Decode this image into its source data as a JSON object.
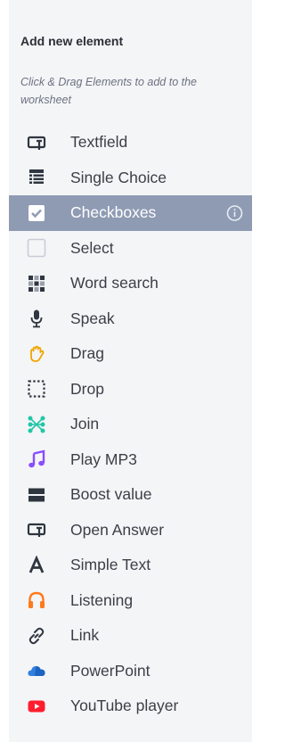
{
  "panel": {
    "title": "Add new element",
    "hint": "Click & Drag Elements to add to the worksheet"
  },
  "elements": [
    {
      "label": "Textfield",
      "icon": "textfield-icon"
    },
    {
      "label": "Single Choice",
      "icon": "single-choice-icon"
    },
    {
      "label": "Checkboxes",
      "icon": "checkbox-icon",
      "selected": true
    },
    {
      "label": "Select",
      "icon": "select-icon"
    },
    {
      "label": "Word search",
      "icon": "word-search-icon"
    },
    {
      "label": "Speak",
      "icon": "microphone-icon"
    },
    {
      "label": "Drag",
      "icon": "hand-icon"
    },
    {
      "label": "Drop",
      "icon": "dotted-box-icon"
    },
    {
      "label": "Join",
      "icon": "join-icon"
    },
    {
      "label": "Play MP3",
      "icon": "music-note-icon"
    },
    {
      "label": "Boost value",
      "icon": "boost-value-icon"
    },
    {
      "label": "Open Answer",
      "icon": "open-answer-icon"
    },
    {
      "label": "Simple Text",
      "icon": "letter-a-icon"
    },
    {
      "label": "Listening",
      "icon": "headphones-icon"
    },
    {
      "label": "Link",
      "icon": "link-icon"
    },
    {
      "label": "PowerPoint",
      "icon": "cloud-icon"
    },
    {
      "label": "YouTube player",
      "icon": "youtube-icon"
    }
  ],
  "colors": {
    "panel_bg": "#f4f5f7",
    "selected_bg": "#8e9bb3",
    "text": "#3a3f47",
    "icon_dark": "#2f3640",
    "drag_orange": "#f2a500",
    "join_green": "#23c6a6",
    "mp3_purple": "#8a4dff",
    "listening_orange": "#ff7a1a",
    "powerpoint_blue": "#2f7fe0",
    "youtube_red": "#ff1d2e"
  }
}
